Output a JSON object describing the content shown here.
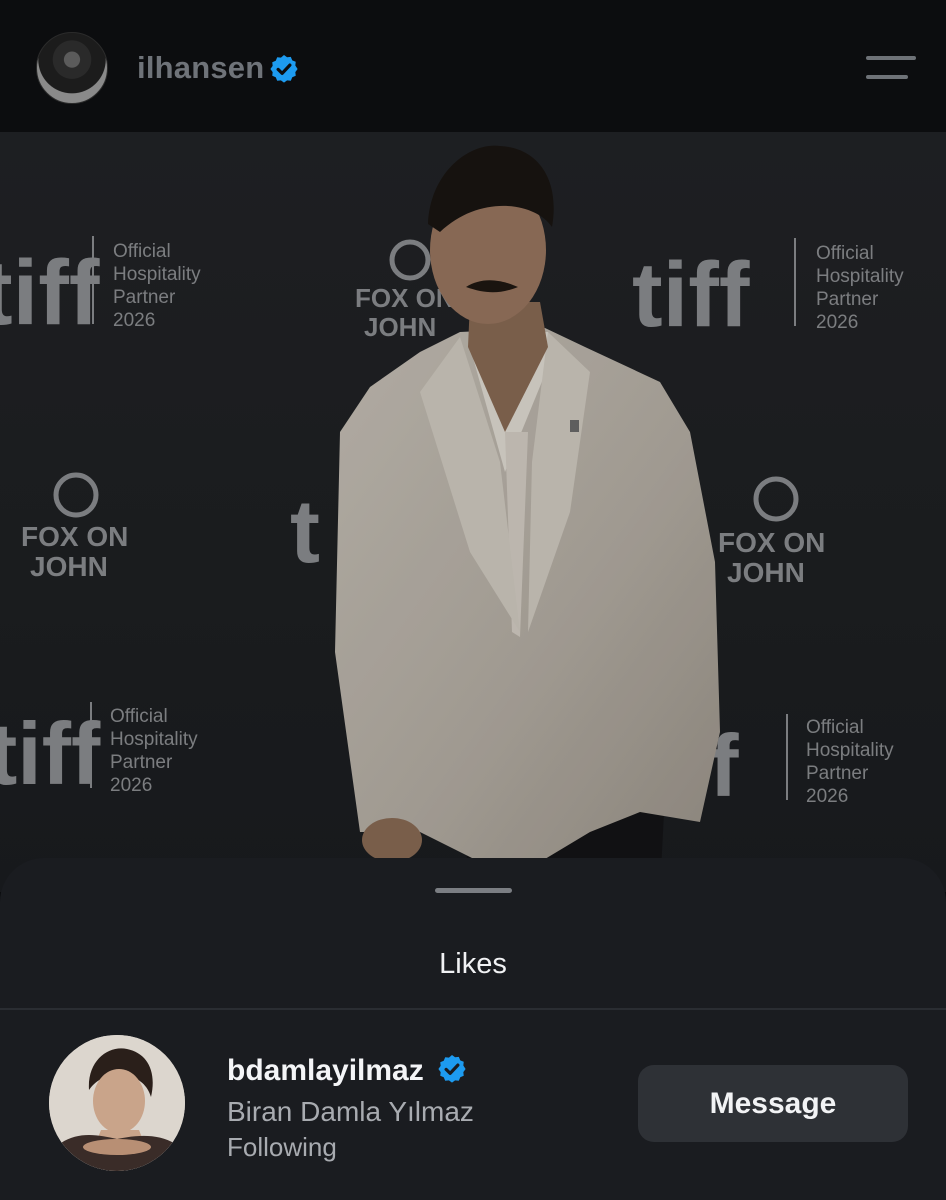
{
  "header": {
    "username": "ilhansen",
    "verified_color": "#1d9bf0"
  },
  "photo": {
    "backdrop": {
      "tiff_logo": "tiff",
      "partner_line1": "Official",
      "partner_line2": "Hospitality",
      "partner_line3": "Partner",
      "partner_line4": "2026",
      "fox_line1": "FOX ON",
      "fox_line2": "JOHN"
    }
  },
  "likes_sheet": {
    "title": "Likes",
    "user": {
      "username": "bdamlayilmaz",
      "full_name": "Biran Damla Yılmaz",
      "status": "Following",
      "button_label": "Message"
    }
  },
  "colors": {
    "background": "#0b0c0e",
    "sheet": "#1a1c20",
    "button": "#2e3136",
    "accent": "#1d9bf0"
  }
}
